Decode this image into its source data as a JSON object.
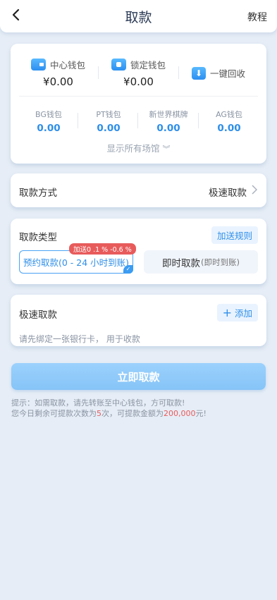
{
  "header": {
    "title": "取款",
    "tutorial_label": "教程"
  },
  "wallets": {
    "center": {
      "label": "中心钱包",
      "amount": "¥0.00"
    },
    "locked": {
      "label": "锁定钱包",
      "amount": "¥0.00"
    },
    "recycle_label": "一键回收"
  },
  "venues": [
    {
      "name": "BG钱包",
      "amount": "0.00"
    },
    {
      "name": "PT钱包",
      "amount": "0.00"
    },
    {
      "name": "新世界棋牌",
      "amount": "0.00"
    },
    {
      "name": "AG钱包",
      "amount": "0.00"
    }
  ],
  "show_all_label": "显示所有场馆",
  "method": {
    "label": "取款方式",
    "value": "极速取款"
  },
  "type": {
    "label": "取款类型",
    "rules_label": "加送规则",
    "bonus_badge": "加送0 .1 % -0.6 %",
    "reserve_label": "预约取款(0 - 24 小时到账)",
    "instant_main": "即时取款",
    "instant_sub": "(即时到账)"
  },
  "bank": {
    "label": "极速取款",
    "add_label": "添加",
    "hint": "请先绑定一张银行卡， 用于收款"
  },
  "submit_label": "立即取款",
  "tips": {
    "line1": "提示：如需取款，请先转账至中心钱包，方可取款!",
    "line2_a": "您今日剩余可提款次数为",
    "count": "5",
    "line2_b": "次，可提款金额为",
    "amount": "200,000",
    "line2_c": "元!"
  },
  "colors": {
    "accent": "#2f8fe8",
    "danger": "#e85b5b",
    "background": "#e6edf6"
  }
}
